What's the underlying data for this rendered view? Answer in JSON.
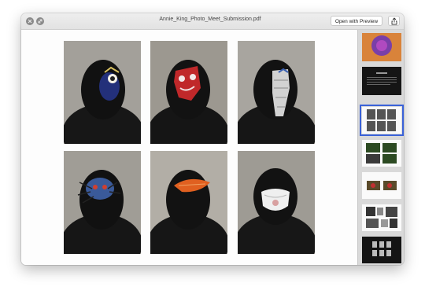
{
  "window": {
    "title": "Annie_King_Photo_Meet_Submission.pdf",
    "open_with_preview_label": "Open with Preview"
  },
  "icons": {
    "close": "close-icon",
    "fullscreen": "fullscreen-icon",
    "share": "share-icon"
  },
  "document": {
    "page_description": "Grid of six portrait photos of a person wearing handmade masks",
    "mask_colors": [
      "#2a3a8a",
      "#c22a2a",
      "#d8d8d8",
      "#3a5a9a",
      "#e06020",
      "#f0f0f0"
    ]
  },
  "sidebar": {
    "selected_index": 2,
    "page_count": 7
  },
  "colors": {
    "accent": "#3a62d8",
    "sidebar_bg": "#d9d9d9",
    "page_bg": "#fdfdfd"
  }
}
